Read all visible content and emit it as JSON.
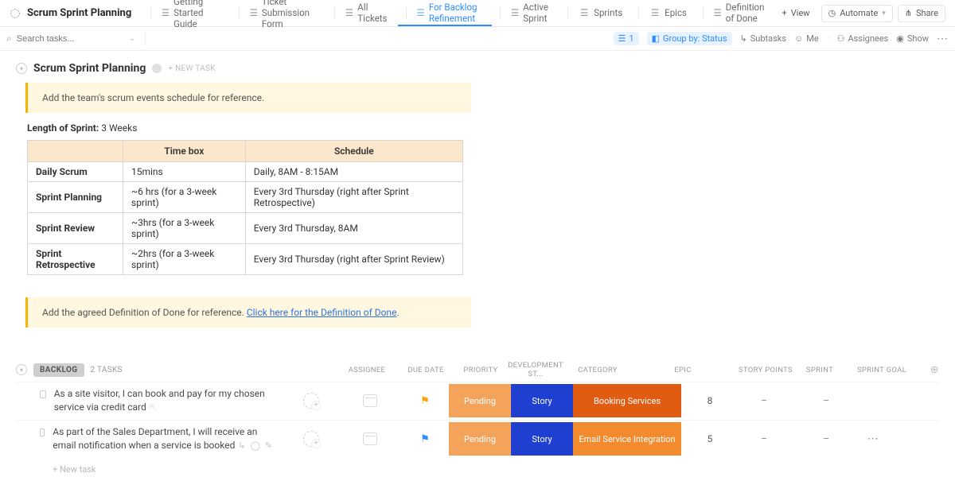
{
  "header": {
    "title": "Scrum Sprint Planning",
    "tabs": [
      {
        "label": "Getting Started Guide",
        "icon": "doc-icon"
      },
      {
        "label": "Ticket Submission Form",
        "icon": "form-icon"
      },
      {
        "label": "All Tickets",
        "icon": "doc-icon"
      },
      {
        "label": "For Backlog Refinement",
        "icon": "list-icon",
        "active": true
      },
      {
        "label": "Active Sprint",
        "icon": "list-icon"
      },
      {
        "label": "Sprints",
        "icon": "list-icon"
      },
      {
        "label": "Epics",
        "icon": "list-icon"
      },
      {
        "label": "Definition of Done",
        "icon": "doc-icon"
      }
    ],
    "add_view": "View",
    "automate": "Automate",
    "share": "Share"
  },
  "toolbar": {
    "search_placeholder": "Search tasks...",
    "filter_count": "1",
    "group_by": "Group by: Status",
    "subtasks": "Subtasks",
    "me": "Me",
    "assignees": "Assignees",
    "show": "Show"
  },
  "listheader": {
    "title": "Scrum Sprint Planning",
    "new_task": "+ NEW TASK"
  },
  "callout1": "Add the team's scrum events schedule for reference.",
  "sprint_length": {
    "label": "Length of Sprint:",
    "value": "3 Weeks"
  },
  "events_table": {
    "headers": [
      "",
      "Time box",
      "Schedule"
    ],
    "rows": [
      {
        "name": "Daily Scrum",
        "timebox": "15mins",
        "schedule": "Daily, 8AM - 8:15AM"
      },
      {
        "name": "Sprint Planning",
        "timebox": "~6 hrs (for a 3-week sprint)",
        "schedule": "Every 3rd Thursday (right after Sprint Retrospective)"
      },
      {
        "name": "Sprint Review",
        "timebox": "~3hrs (for a 3-week sprint)",
        "schedule": "Every 3rd Thursday, 8AM"
      },
      {
        "name": "Sprint Retrospective",
        "timebox": "~2hrs (for a 3-week sprint)",
        "schedule": "Every 3rd Thursday (right after Sprint Review)"
      }
    ]
  },
  "callout2": {
    "text": "Add the agreed Definition of Done for reference. ",
    "link": "Click here for the Definition of Done",
    "tail": "."
  },
  "group": {
    "name": "BACKLOG",
    "count": "2 TASKS",
    "columns": [
      "ASSIGNEE",
      "DUE DATE",
      "PRIORITY",
      "DEVELOPMENT ST...",
      "CATEGORY",
      "EPIC",
      "STORY POINTS",
      "SPRINT",
      "SPRINT GOAL"
    ],
    "tasks": [
      {
        "name": "As a site visitor, I can book and pay for my chosen service via credit card",
        "priority_color": "orange",
        "dev_status": {
          "label": "Pending",
          "bg": "#f3a45a"
        },
        "category": {
          "label": "Story",
          "bg": "#1f3fd1"
        },
        "epic": {
          "label": "Booking Services",
          "bg": "#e25b12"
        },
        "story_points": "8",
        "sprint": "–",
        "goal": "–",
        "show_hover_icons": false,
        "show_more": false
      },
      {
        "name": "As part of the Sales Department, I will receive an email notification when a service is booked",
        "priority_color": "blue",
        "dev_status": {
          "label": "Pending",
          "bg": "#f3a45a"
        },
        "category": {
          "label": "Story",
          "bg": "#1f3fd1"
        },
        "epic": {
          "label": "Email Service Integration",
          "bg": "#f28a2e"
        },
        "story_points": "5",
        "sprint": "–",
        "goal": "–",
        "show_hover_icons": true,
        "show_more": true
      }
    ],
    "new_task": "+ New task"
  }
}
